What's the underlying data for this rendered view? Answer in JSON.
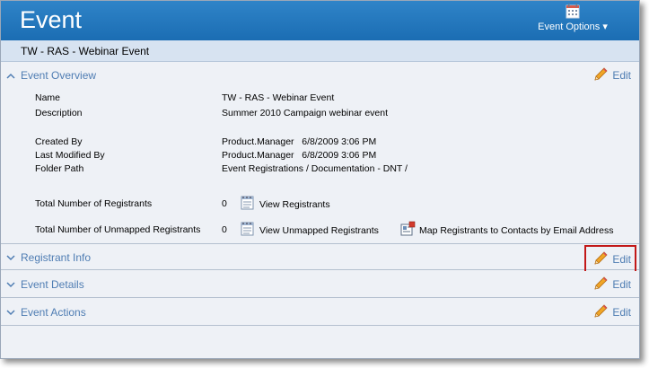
{
  "header": {
    "title": "Event",
    "options_label": "Event Options",
    "options_icon": "calendar-icon"
  },
  "subtitle": "TW - RAS - Webinar Event",
  "sections": {
    "overview": {
      "title": "Event Overview",
      "edit_label": "Edit"
    },
    "registrant_info": {
      "title": "Registrant Info",
      "edit_label": "Edit"
    },
    "details": {
      "title": "Event Details",
      "edit_label": "Edit"
    },
    "actions": {
      "title": "Event Actions",
      "edit_label": "Edit"
    }
  },
  "overview": {
    "name_label": "Name",
    "name_value": "TW - RAS - Webinar Event",
    "description_label": "Description",
    "description_value": "Summer 2010 Campaign webinar event",
    "created_by_label": "Created By",
    "created_by_value": "Product.Manager   6/8/2009 3:06 PM",
    "modified_by_label": "Last Modified By",
    "modified_by_value": "Product.Manager   6/8/2009 3:06 PM",
    "folder_label": "Folder Path",
    "folder_value": "Event Registrations / Documentation - DNT /",
    "total_registrants_label": "Total Number of Registrants",
    "total_registrants_value": "0",
    "view_registrants": "View Registrants",
    "total_unmapped_label": "Total Number of Unmapped Registrants",
    "total_unmapped_value": "0",
    "view_unmapped": "View Unmapped Registrants",
    "map_registrants": "Map Registrants to Contacts by Email Address"
  },
  "colors": {
    "header_blue": "#1f73b8",
    "section_title": "#4f7db3",
    "highlight_red": "#c21818"
  }
}
